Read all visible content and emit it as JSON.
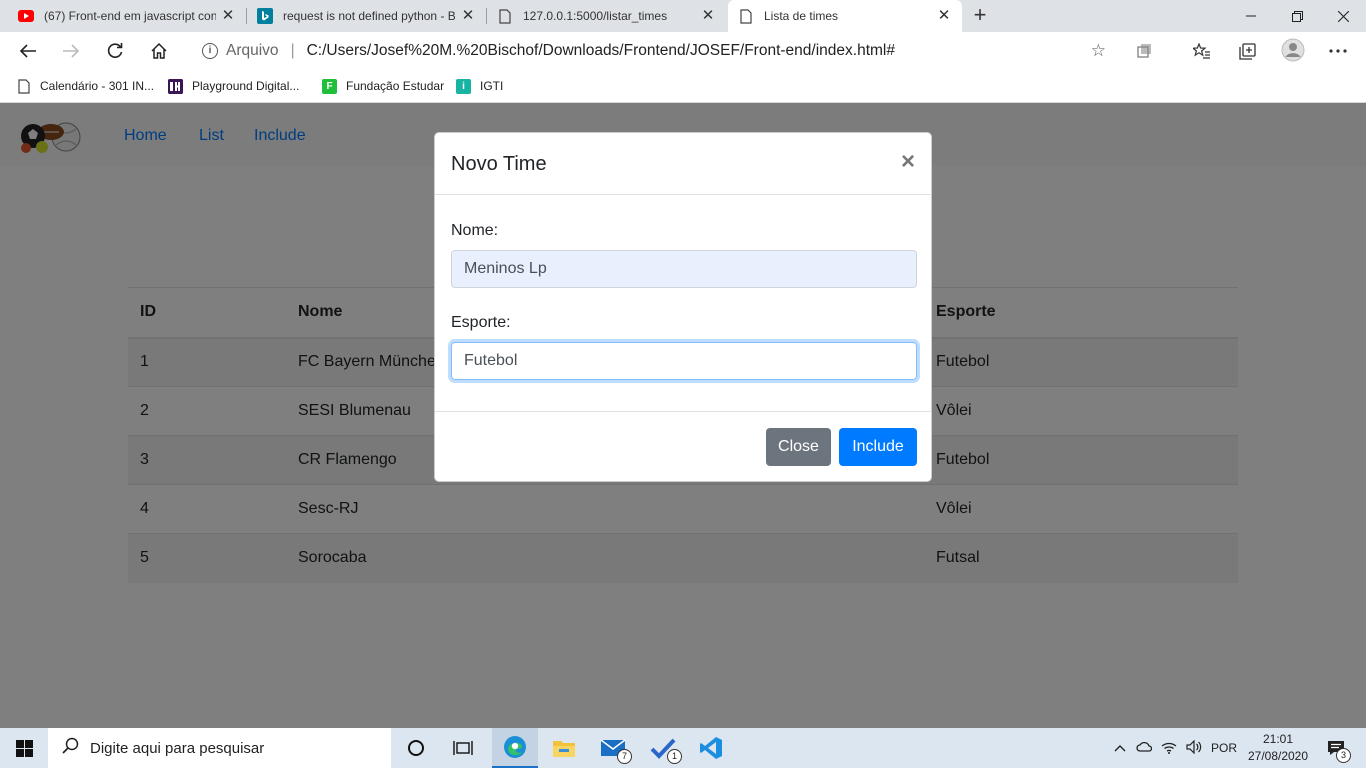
{
  "browser": {
    "tabs": [
      {
        "title": "(67) Front-end em javascript con",
        "favicon": "youtube-icon",
        "active": false
      },
      {
        "title": "request is not defined python - B",
        "favicon": "bing-icon",
        "active": false
      },
      {
        "title": "127.0.0.1:5000/listar_times",
        "favicon": "page-icon",
        "active": false
      },
      {
        "title": "Lista de times",
        "favicon": "page-icon",
        "active": true
      }
    ],
    "address": {
      "scheme_label": "Arquivo",
      "url": "C:/Users/Josef%20M.%20Bischof/Downloads/Frontend/JOSEF/Front-end/index.html#"
    },
    "bookmarks": [
      {
        "label": "Calendário - 301 IN...",
        "icon": "page-icon"
      },
      {
        "label": "Playground Digital...",
        "icon": "playground-icon"
      },
      {
        "label": "Fundação Estudar",
        "icon": "fundacao-icon"
      },
      {
        "label": "IGTI",
        "icon": "igti-icon"
      }
    ]
  },
  "site": {
    "nav": [
      "Home",
      "List",
      "Include"
    ],
    "table": {
      "headers": [
        "ID",
        "Nome",
        "Esporte"
      ],
      "rows": [
        {
          "id": "1",
          "nome": "FC Bayern München",
          "esporte": "Futebol"
        },
        {
          "id": "2",
          "nome": "SESI Blumenau",
          "esporte": "Vôlei"
        },
        {
          "id": "3",
          "nome": "CR Flamengo",
          "esporte": "Futebol"
        },
        {
          "id": "4",
          "nome": "Sesc-RJ",
          "esporte": "Vôlei"
        },
        {
          "id": "5",
          "nome": "Sorocaba",
          "esporte": "Futsal"
        }
      ]
    }
  },
  "modal": {
    "title": "Novo Time",
    "close_glyph": "×",
    "nome_label": "Nome:",
    "nome_value": "Meninos Lp",
    "esporte_label": "Esporte:",
    "esporte_value": "Futebol",
    "close_button": "Close",
    "include_button": "Include"
  },
  "taskbar": {
    "search_placeholder": "Digite aqui para pesquisar",
    "mail_badge": "7",
    "todo_badge": "1",
    "language": "POR",
    "time": "21:01",
    "date": "27/08/2020",
    "notifications": "3"
  },
  "colors": {
    "link": "#007bff",
    "primary": "#007bff",
    "secondary": "#6c757d"
  }
}
